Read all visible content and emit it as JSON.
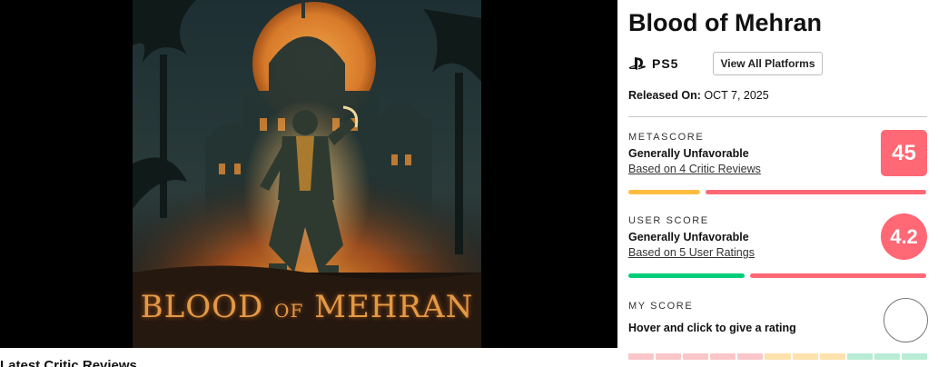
{
  "game": {
    "title": "Blood of Mehran",
    "cover_title_main": "BLOOD",
    "cover_title_of": "OF",
    "cover_title_end": "MEHRAN"
  },
  "platform": {
    "icon": "playstation-icon",
    "label": "PS5",
    "view_all_label": "View All Platforms"
  },
  "release": {
    "label": "Released On:",
    "date": "OCT 7, 2025"
  },
  "metascore": {
    "label": "METASCORE",
    "verdict": "Generally Unfavorable",
    "link": "Based on 4 Critic Reviews",
    "value": "45",
    "color": "#ff6874",
    "distribution_colors": [
      "#ffbd3f",
      "#ff6874"
    ]
  },
  "userscore": {
    "label": "USER SCORE",
    "verdict": "Generally Unfavorable",
    "link": "Based on 5 User Ratings",
    "value": "4.2",
    "color": "#ff6874",
    "distribution_colors": [
      "#00ce7a",
      "#ff6874"
    ]
  },
  "myscore": {
    "label": "MY SCORE",
    "prompt": "Hover and click to give a rating",
    "scale_colors": [
      "#fbc6c8",
      "#fbc6c8",
      "#fbc6c8",
      "#fbc6c8",
      "#fbc6c8",
      "#fde2ad",
      "#fde2ad",
      "#fde2ad",
      "#b8ecd4",
      "#b8ecd4",
      "#b8ecd4"
    ]
  },
  "section": {
    "heading": "Latest Critic Reviews"
  }
}
